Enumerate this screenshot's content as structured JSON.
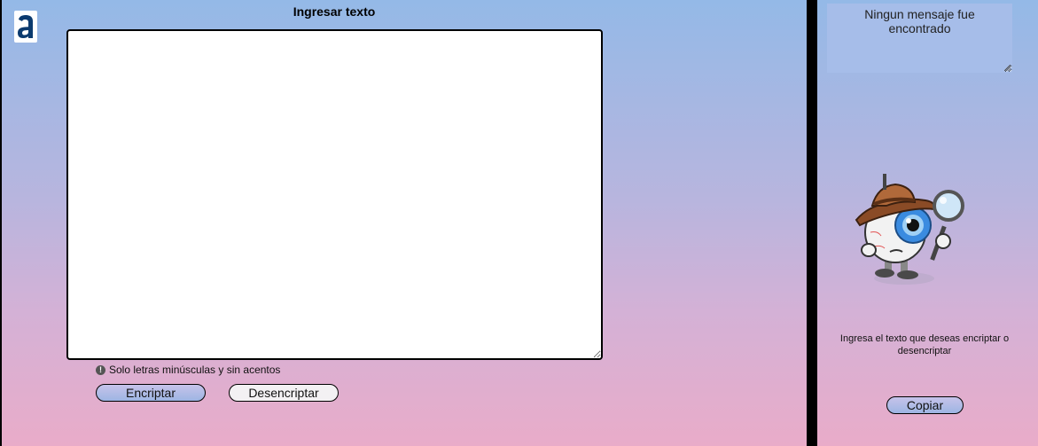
{
  "left": {
    "logo_letter": "a",
    "input_title": "Ingresar texto",
    "input_value": "",
    "hint_text": "Solo letras minúsculas y sin acentos",
    "encrypt_label": "Encriptar",
    "decrypt_label": "Desencriptar"
  },
  "right": {
    "output_message": "Ningun mensaje fue encontrado",
    "instruction": "Ingresa el texto que deseas encriptar o desencriptar",
    "copy_label": "Copiar"
  },
  "icons": {
    "logo": "alura-logo-icon",
    "hint": "info-icon",
    "mascot": "detective-eye-icon"
  },
  "colors": {
    "gradient_top": "#94b9e7",
    "gradient_bottom": "#e9acc9",
    "divider": "#000000",
    "logo_blue": "#0b3a6e"
  }
}
